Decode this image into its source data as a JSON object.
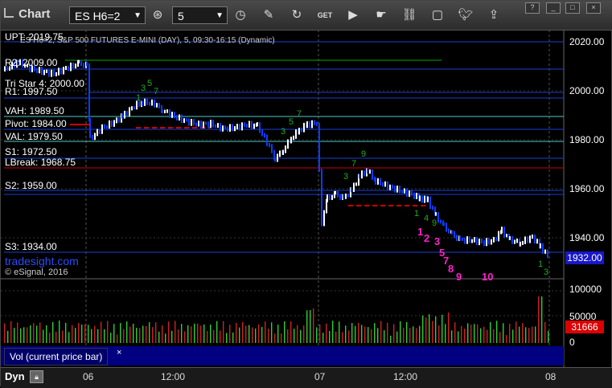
{
  "toolbar": {
    "title": "Chart",
    "symbol": "ES H6=2",
    "interval": "5",
    "icons": [
      "crosshair-icon",
      "clock-icon",
      "pencil-icon",
      "refresh-icon",
      "get-icon",
      "play-icon",
      "link-icon",
      "comment-icon",
      "twitter-icon",
      "share-icon"
    ]
  },
  "window_buttons": [
    "?",
    "_",
    "□",
    "×"
  ],
  "chart_header": "ES H6=2, S&P 500 FUTURES E-MINI (DAY), 5, 09:30-16:15 (Dynamic)",
  "levels": {
    "upt": "UPT: 2019.75",
    "r2": "R2: 2009.00",
    "tristar": "Tri Star 4: 2000.00",
    "r1": "R1: 1997.50",
    "vah": "VAH: 1989.50",
    "pivot": "Pivot: 1984.00",
    "val": "VAL: 1979.50",
    "s1": "S1: 1972.50",
    "lbreak": "LBreak: 1968.75",
    "s2": "S2: 1959.00",
    "s3": "S3: 1934.00"
  },
  "price_axis": [
    "2020.00",
    "2000.00",
    "1980.00",
    "1960.00",
    "1940.00"
  ],
  "current_price": "1932.00",
  "watermark": "tradesight.com",
  "copyright": "© eSignal, 2016",
  "volume": {
    "label": "Vol (current price bar)",
    "close_icon": "×",
    "axis": [
      "100000",
      "50000",
      "0"
    ],
    "current": "31666"
  },
  "bottom": {
    "dyn": "Dyn",
    "dates": [
      "06",
      "12:00",
      "07",
      "12:00",
      "08"
    ]
  },
  "seq_numbers_pink": [
    "1",
    "2",
    "3",
    "5",
    "7",
    "8",
    "9",
    "10"
  ],
  "colors": {
    "bullish": "#ffffff",
    "bearish": "#0b3cff",
    "resistance": "#1a3fd4",
    "upt": "#00aa00",
    "pivot_red": "#cc0000",
    "pink": "#ff22cc",
    "green_count": "#22aa22",
    "current_price_bg": "#1818c8"
  }
}
